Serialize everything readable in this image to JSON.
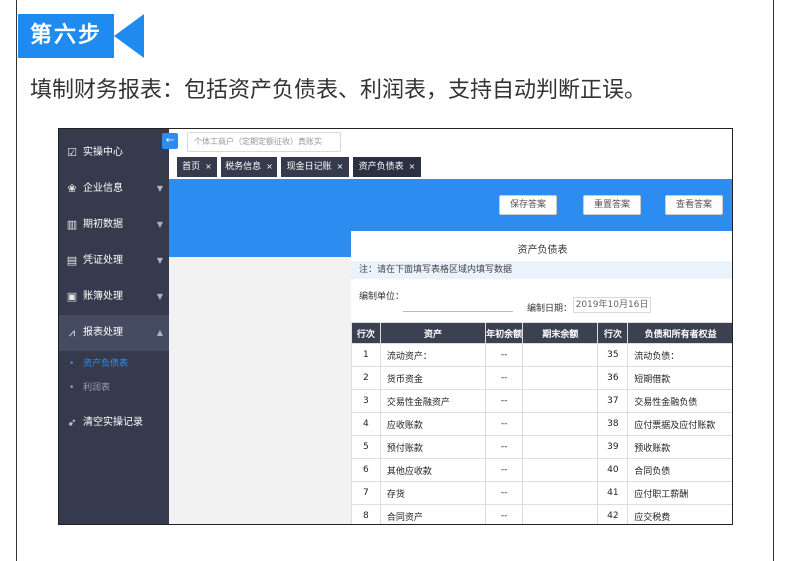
{
  "step": {
    "label": "第六步"
  },
  "headline": "填制财务报表：包括资产负债表、利润表，支持自动判断正误。",
  "sidebar": {
    "items": [
      {
        "label": "实操中心",
        "icon": "chart-line-icon"
      },
      {
        "label": "企业信息",
        "icon": "group-icon"
      },
      {
        "label": "期初数据",
        "icon": "bar-chart-icon"
      },
      {
        "label": "凭证处理",
        "icon": "document-icon"
      },
      {
        "label": "账簿处理",
        "icon": "clipboard-icon"
      },
      {
        "label": "报表处理",
        "icon": "trend-icon"
      },
      {
        "label": "清空实操记录",
        "icon": "send-icon"
      }
    ],
    "subitems": [
      {
        "label": "资产负债表"
      },
      {
        "label": "利润表"
      }
    ]
  },
  "topbar": {
    "company": "个体工商户（定期定额征收）真账实"
  },
  "tabs": [
    {
      "label": "首页",
      "close": "×"
    },
    {
      "label": "税务信息",
      "close": "×"
    },
    {
      "label": "现金日记账",
      "close": "×"
    },
    {
      "label": "资产负债表",
      "close": "×"
    }
  ],
  "buttons": {
    "save": "保存答案",
    "reset": "重置答案",
    "view": "查看答案"
  },
  "sheet": {
    "title": "资产负债表",
    "note": "注：请在下面填写表格区域内填写数据",
    "unit_label": "编制单位：",
    "date_label": "编制日期：",
    "date_value": "2019年10月16日",
    "columns": [
      "行次",
      "资产",
      "年初余额",
      "期末余额",
      "行次",
      "负债和所有者权益"
    ],
    "rows": [
      {
        "n1": "1",
        "asset": "流动资产：",
        "begin": "--",
        "end": "",
        "n2": "35",
        "liab": "流动负债："
      },
      {
        "n1": "2",
        "asset": "货币资金",
        "begin": "--",
        "end": "",
        "n2": "36",
        "liab": "短期借款"
      },
      {
        "n1": "3",
        "asset": "交易性金融资产",
        "begin": "--",
        "end": "",
        "n2": "37",
        "liab": "交易性金融负债"
      },
      {
        "n1": "4",
        "asset": "应收账款",
        "begin": "--",
        "end": "",
        "n2": "38",
        "liab": "应付票据及应付账款"
      },
      {
        "n1": "5",
        "asset": "预付账款",
        "begin": "--",
        "end": "",
        "n2": "39",
        "liab": "预收账款"
      },
      {
        "n1": "6",
        "asset": "其他应收款",
        "begin": "--",
        "end": "",
        "n2": "40",
        "liab": "合同负债"
      },
      {
        "n1": "7",
        "asset": "存货",
        "begin": "--",
        "end": "",
        "n2": "41",
        "liab": "应付职工薪酬"
      },
      {
        "n1": "8",
        "asset": "合同资产",
        "begin": "--",
        "end": "",
        "n2": "42",
        "liab": "应交税费"
      }
    ]
  }
}
